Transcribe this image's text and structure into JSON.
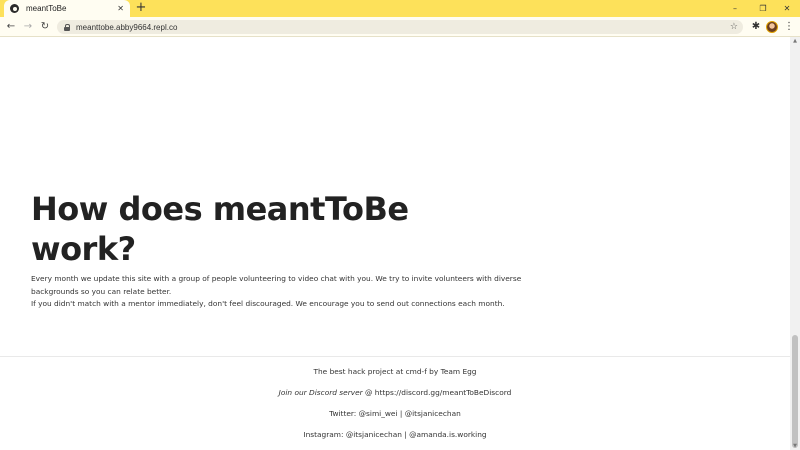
{
  "browser": {
    "tab_title": "meantToBe",
    "tab_close": "✕",
    "new_tab": "+",
    "window_controls": {
      "minimize": "–",
      "restore": "❐",
      "close": "✕"
    },
    "nav": {
      "back": "←",
      "forward": "→",
      "reload": "↻"
    },
    "url": "meanttobe.abby9664.repl.co",
    "bookmark_star": "☆",
    "extensions_icon": "✱",
    "menu_icon": "⋮"
  },
  "main": {
    "heading": "How does meantToBe work?",
    "paragraph_1": "Every month we update this site with a group of people volunteering to video chat with you. We try to invite volunteers with diverse backgrounds so you can relate better.",
    "paragraph_2": "If you didn't match with a mentor immediately, don't feel discouraged. We encourage you to send out connections each month."
  },
  "footer": {
    "credits": "The best hack project at cmd-f by Team Egg",
    "discord_label": "Join our Discord server",
    "discord_sep": " @ ",
    "discord_url": "https://discord.gg/meantToBeDiscord",
    "twitter": "Twitter: @simi_wei | @itsjanicechan",
    "instagram": "Instagram: @itsjanicechan | @amanda.is.working"
  },
  "colors": {
    "tabbar": "#fde15a",
    "heading": "#222222",
    "text": "#333333"
  }
}
